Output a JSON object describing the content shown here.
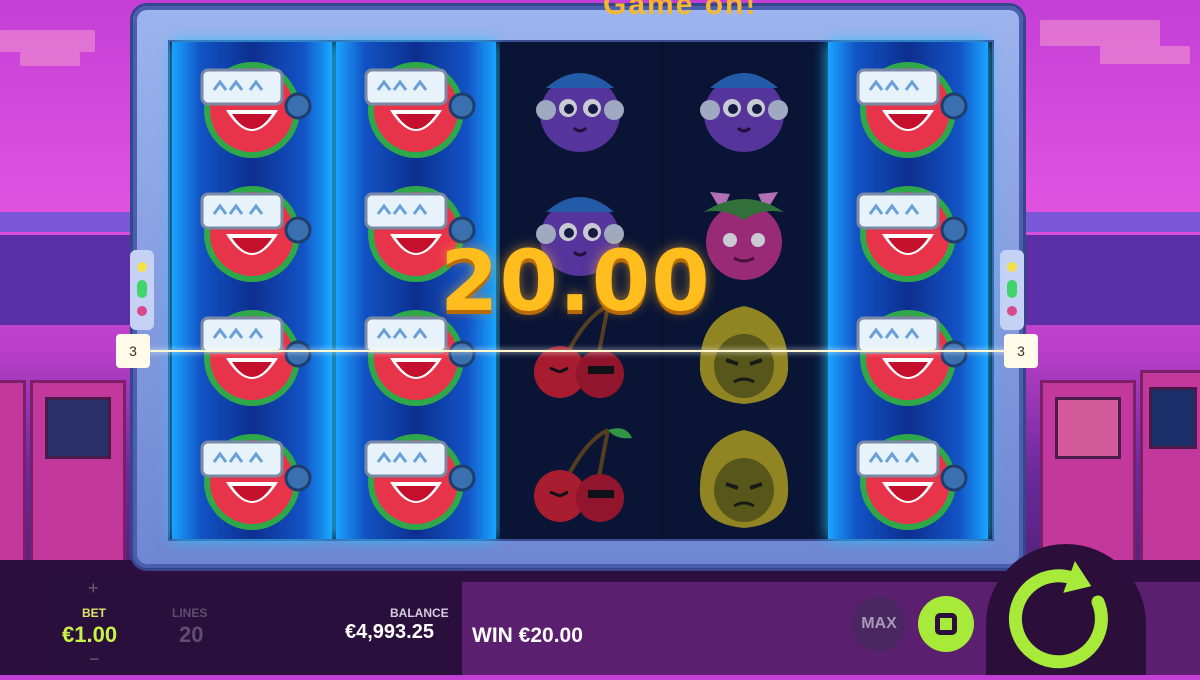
{
  "game": {
    "title": "Game on!",
    "big_win_amount": "20.00",
    "active_line_left": "3",
    "active_line_right": "3"
  },
  "reels": [
    [
      "watermelon",
      "watermelon",
      "watermelon",
      "watermelon"
    ],
    [
      "watermelon",
      "watermelon",
      "watermelon",
      "watermelon"
    ],
    [
      "plum",
      "plum",
      "cherries",
      "cherries"
    ],
    [
      "plum",
      "grape-cat",
      "lemon-hood",
      "lemon-hood"
    ],
    [
      "watermelon",
      "watermelon",
      "watermelon",
      "watermelon"
    ]
  ],
  "reel_highlight": [
    true,
    true,
    false,
    false,
    true
  ],
  "hud": {
    "plus": "+",
    "minus": "−",
    "bet_label": "BET",
    "bet_value": "€1.00",
    "lines_label": "LINES",
    "lines_value": "20",
    "balance_label": "BALANCE",
    "balance_value": "€4,993.25",
    "win_text": "WIN €20.00",
    "max_label": "MAX"
  },
  "colors": {
    "accent_green": "#a7ea3a",
    "win_gold": "#ffbd1e",
    "reel_glow": "#27c4ff"
  }
}
